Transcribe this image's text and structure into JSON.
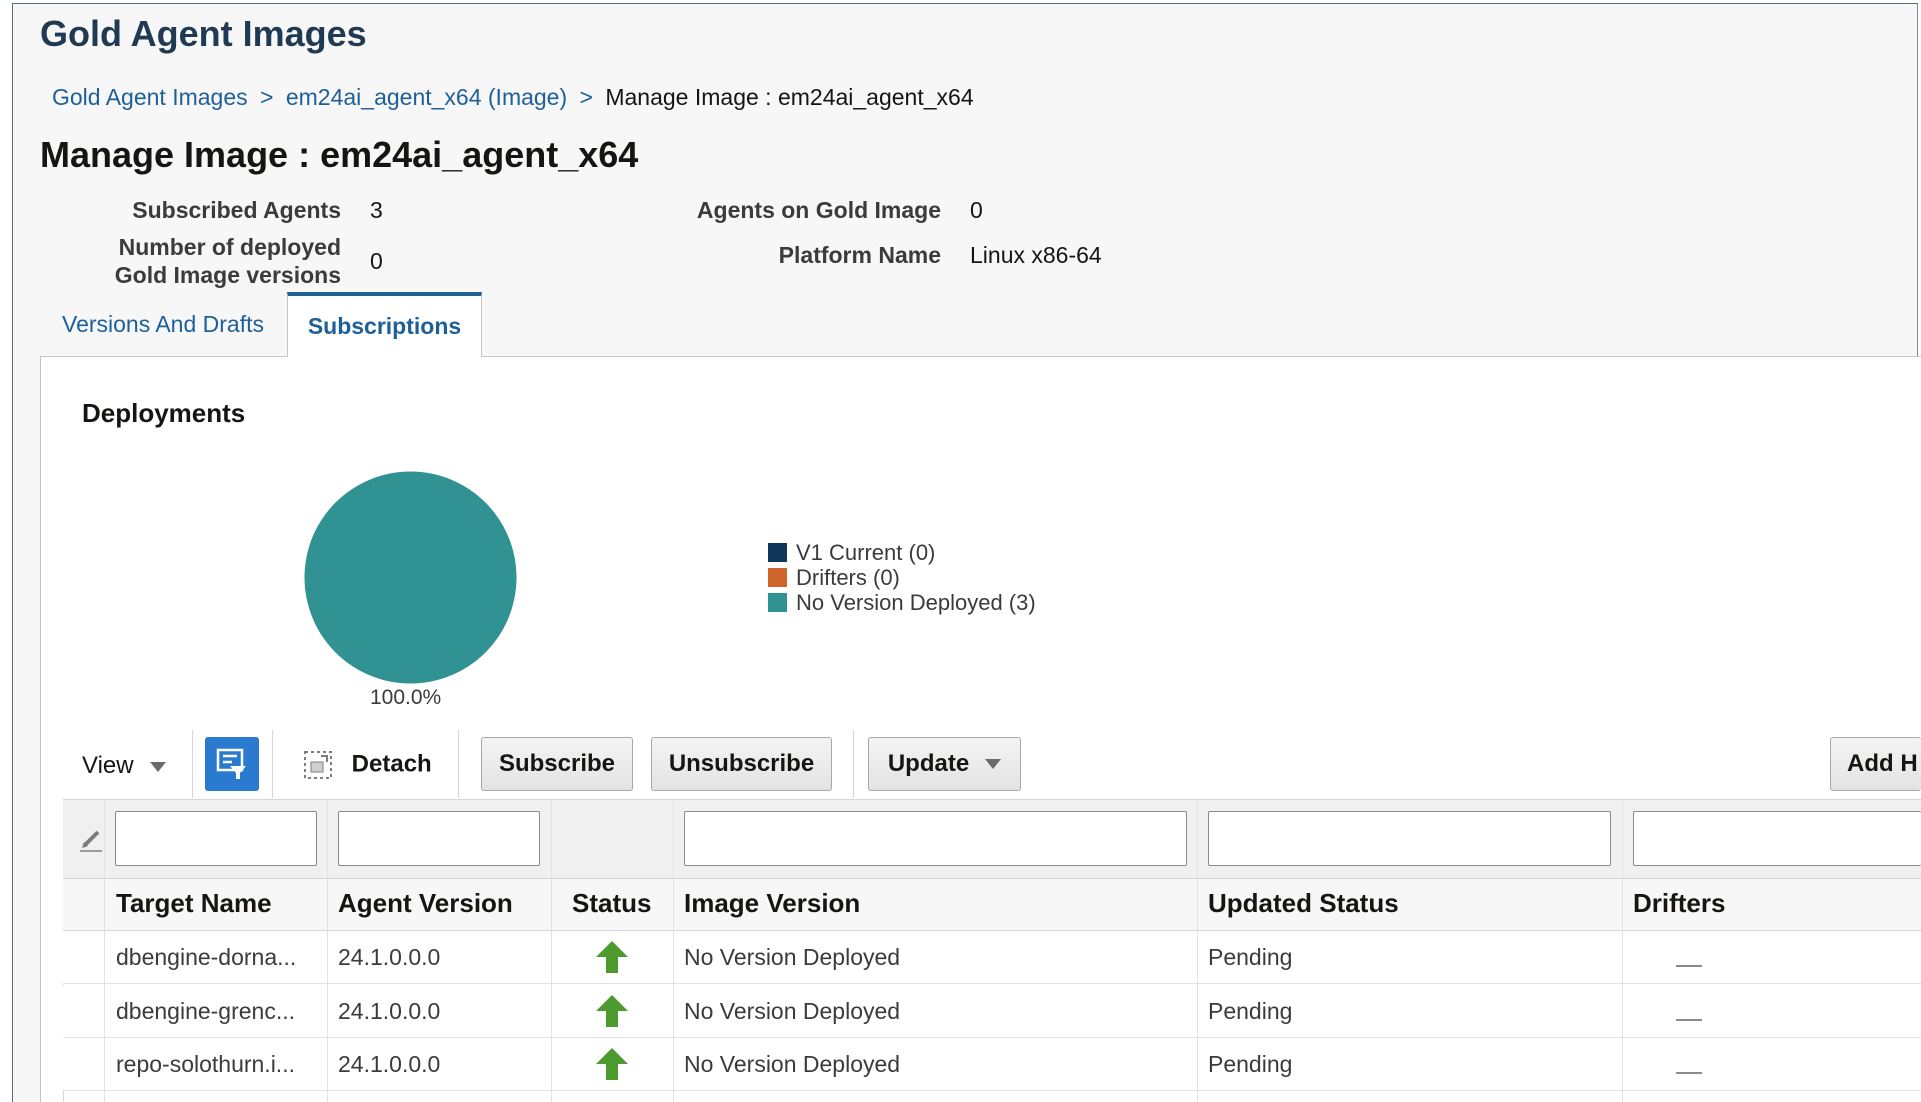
{
  "app": {
    "title": "Gold Agent Images"
  },
  "breadcrumb": {
    "items": [
      "Gold Agent Images",
      "em24ai_agent_x64 (Image)"
    ],
    "separator": ">",
    "current": "Manage Image : em24ai_agent_x64"
  },
  "page": {
    "title": "Manage Image : em24ai_agent_x64"
  },
  "info": {
    "subscribed_agents_label": "Subscribed Agents",
    "subscribed_agents_value": "3",
    "deployed_versions_label_line1": "Number of deployed",
    "deployed_versions_label_line2": "Gold Image versions",
    "deployed_versions_value": "0",
    "agents_on_gold_label": "Agents on Gold Image",
    "agents_on_gold_value": "0",
    "platform_label": "Platform Name",
    "platform_value": "Linux x86-64"
  },
  "tabs": [
    {
      "label": "Versions And Drafts",
      "selected": false
    },
    {
      "label": "Subscriptions",
      "selected": true
    }
  ],
  "deployments": {
    "title": "Deployments",
    "pie_label": "100.0%"
  },
  "chart_data": {
    "type": "pie",
    "categories": [
      "V1 Current",
      "Drifters",
      "No Version Deployed"
    ],
    "values": [
      0,
      0,
      3
    ],
    "colors": [
      "#10365c",
      "#d0652c",
      "#309292"
    ],
    "legend": [
      "V1 Current (0)",
      "Drifters (0)",
      "No Version Deployed (3)"
    ],
    "legend_placement": "right"
  },
  "toolbar": {
    "view_label": "View",
    "detach_label": "Detach",
    "subscribe_label": "Subscribe",
    "unsubscribe_label": "Unsubscribe",
    "update_label": "Update",
    "add_label": "Add H"
  },
  "table": {
    "columns": [
      "Target Name",
      "Agent Version",
      "Status",
      "Image Version",
      "Updated Status",
      "Drifters"
    ],
    "rows": [
      {
        "target": "dbengine-dorna...",
        "agent_version": "24.1.0.0.0",
        "status": "up-arrow-icon",
        "image_version": "No Version Deployed",
        "updated_status": "Pending",
        "drifters": ""
      },
      {
        "target": "dbengine-grenc...",
        "agent_version": "24.1.0.0.0",
        "status": "up-arrow-icon",
        "image_version": "No Version Deployed",
        "updated_status": "Pending",
        "drifters": ""
      },
      {
        "target": "repo-solothurn.i...",
        "agent_version": "24.1.0.0.0",
        "status": "up-arrow-icon",
        "image_version": "No Version Deployed",
        "updated_status": "Pending",
        "drifters": ""
      }
    ]
  },
  "colors": {
    "link": "#1e5f9a",
    "title": "#1f3a52",
    "status_up": "#4d9a2e",
    "filter_button": "#2a7ad0"
  }
}
